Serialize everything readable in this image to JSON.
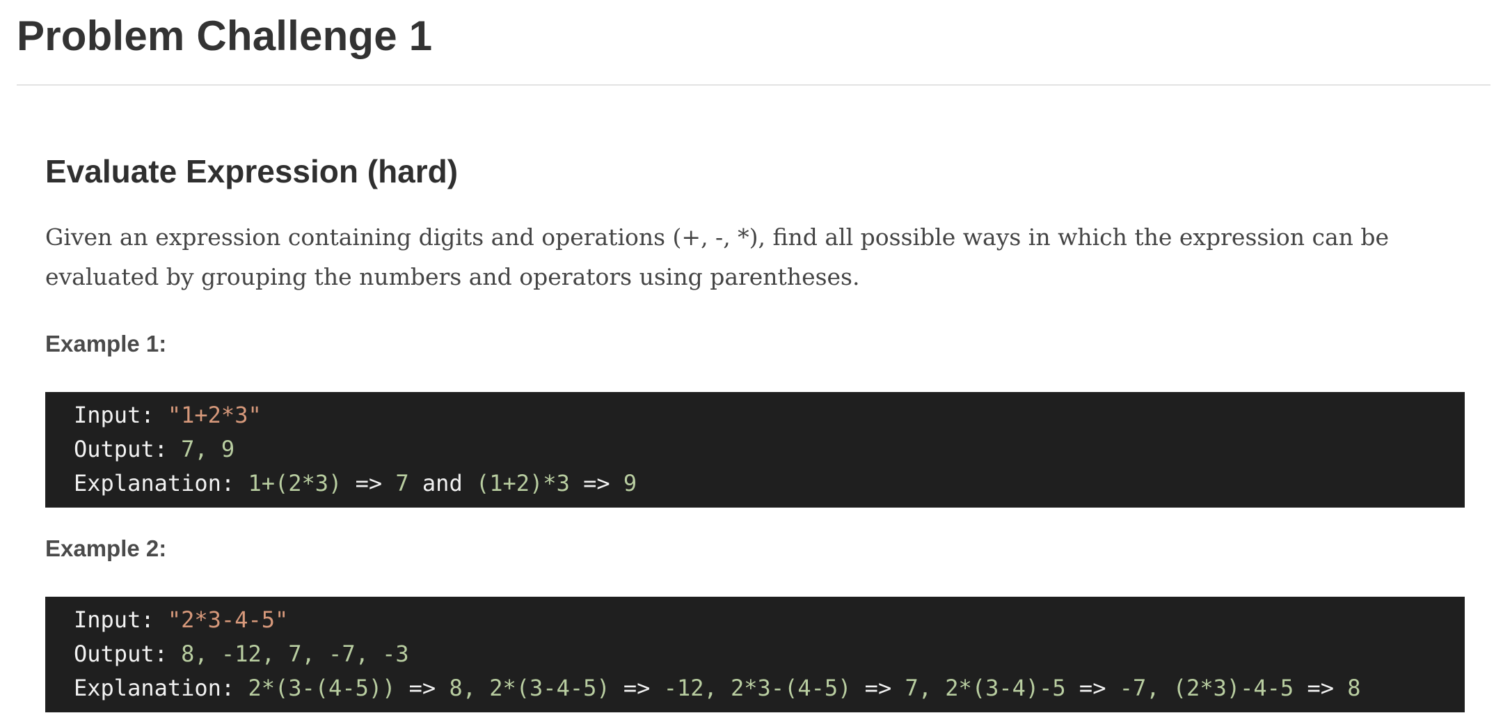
{
  "page": {
    "title": "Problem Challenge 1"
  },
  "problem": {
    "heading": "Evaluate Expression (hard)",
    "description": "Given an expression containing digits and operations (+, -, *), find all possible ways in which the expression can be evaluated by grouping the numbers and operators using parentheses."
  },
  "examples": [
    {
      "label": "Example 1:",
      "lines": [
        [
          {
            "t": "Input: ",
            "c": "plain"
          },
          {
            "t": "\"1+2*3\"",
            "c": "str"
          }
        ],
        [
          {
            "t": "Output: ",
            "c": "plain"
          },
          {
            "t": "7, 9",
            "c": "num"
          }
        ],
        [
          {
            "t": "Explanation: ",
            "c": "plain"
          },
          {
            "t": "1+(2*3)",
            "c": "num"
          },
          {
            "t": " => ",
            "c": "plain"
          },
          {
            "t": "7",
            "c": "num"
          },
          {
            "t": " and ",
            "c": "plain"
          },
          {
            "t": "(1+2)*3",
            "c": "num"
          },
          {
            "t": " => ",
            "c": "plain"
          },
          {
            "t": "9",
            "c": "num"
          }
        ]
      ]
    },
    {
      "label": "Example 2:",
      "lines": [
        [
          {
            "t": "Input: ",
            "c": "plain"
          },
          {
            "t": "\"2*3-4-5\"",
            "c": "str"
          }
        ],
        [
          {
            "t": "Output: ",
            "c": "plain"
          },
          {
            "t": "8, -12, 7, -7, -3",
            "c": "num"
          }
        ],
        [
          {
            "t": "Explanation: ",
            "c": "plain"
          },
          {
            "t": "2*(3-(4-5))",
            "c": "num"
          },
          {
            "t": " => ",
            "c": "plain"
          },
          {
            "t": "8, 2*(3-4-5)",
            "c": "num"
          },
          {
            "t": " => ",
            "c": "plain"
          },
          {
            "t": "-12, 2*3-(4-5)",
            "c": "num"
          },
          {
            "t": " => ",
            "c": "plain"
          },
          {
            "t": "7, 2*(3-4)-5",
            "c": "num"
          },
          {
            "t": " => ",
            "c": "plain"
          },
          {
            "t": "-7, (2*3)-4-5",
            "c": "num"
          },
          {
            "t": " => ",
            "c": "plain"
          },
          {
            "t": "8",
            "c": "num"
          }
        ]
      ]
    }
  ],
  "colors": {
    "code_background": "#1f1f1f",
    "code_text": "#f2f2f2",
    "string_literal": "#d7997b",
    "numeric_literal": "#b9cea1",
    "heading_text": "#333333"
  }
}
